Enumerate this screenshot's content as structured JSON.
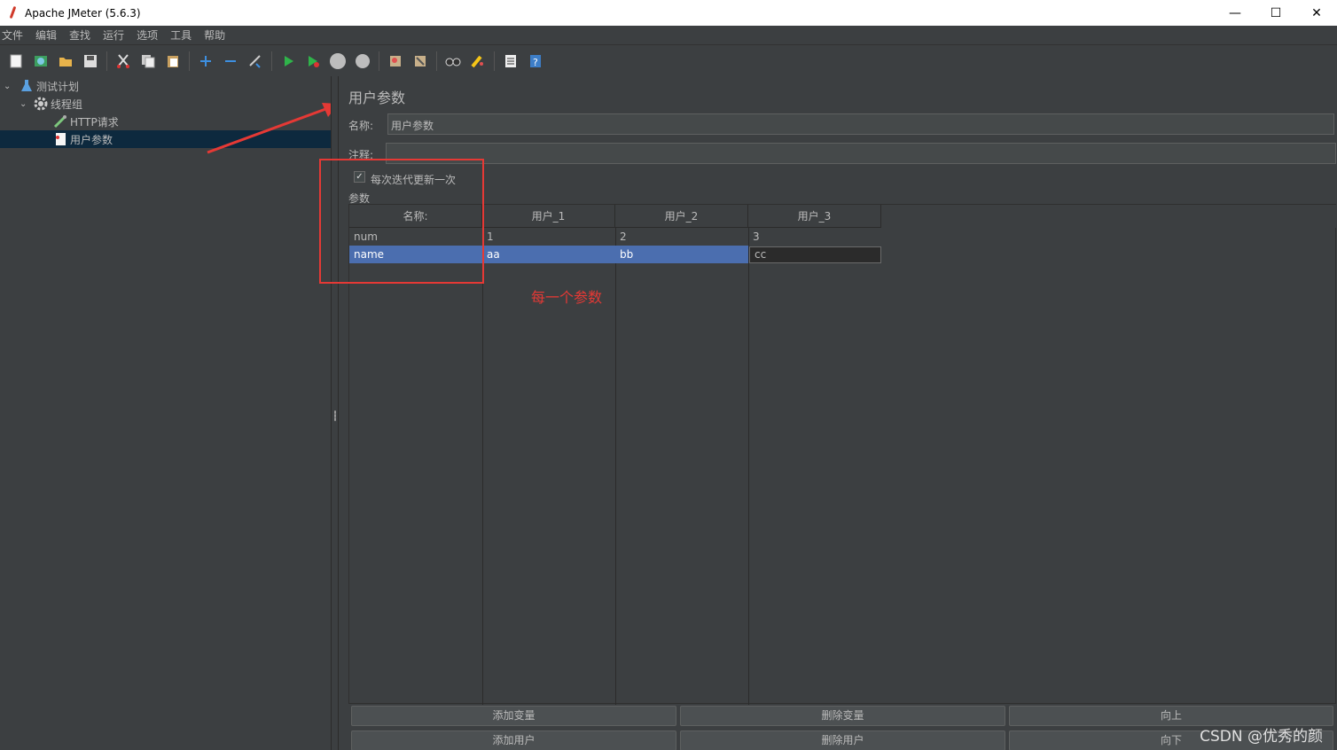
{
  "window": {
    "title": "Apache JMeter (5.6.3)",
    "min": "—",
    "max": "☐",
    "close": "✕"
  },
  "menu": [
    "文件",
    "编辑",
    "查找",
    "运行",
    "选项",
    "工具",
    "帮助"
  ],
  "toolbar_icons": [
    "new-icon",
    "templates-icon",
    "open-icon",
    "save-icon",
    "cut-icon",
    "copy-icon",
    "paste-icon",
    "expand-icon",
    "collapse-icon",
    "toggle-icon",
    "start-icon",
    "start-no-pause-icon",
    "stop-icon",
    "shutdown-icon",
    "clear-icon",
    "clear-all-icon",
    "search-icon",
    "reset-search-icon",
    "function-helper-icon",
    "help-icon"
  ],
  "tree": {
    "test_plan": "测试计划",
    "thread_group": "线程组",
    "http_request": "HTTP请求",
    "user_params": "用户参数"
  },
  "panel": {
    "title": "用户参数",
    "name_label": "名称:",
    "name_value": "用户参数",
    "comment_label": "注释:",
    "comment_value": "",
    "checkbox_label": "每次迭代更新一次",
    "checkbox_checked": true,
    "params_label": "参数"
  },
  "table": {
    "headers": [
      "名称:",
      "用户_1",
      "用户_2",
      "用户_3"
    ],
    "rows": [
      [
        "num",
        "1",
        "2",
        "3"
      ],
      [
        "name",
        "aa",
        "bb",
        "cc"
      ]
    ]
  },
  "buttons": {
    "add_var": "添加变量",
    "del_var": "删除变量",
    "up": "向上",
    "add_user": "添加用户",
    "del_user": "删除用户",
    "down": "向下"
  },
  "annotation": {
    "note": "每一个参数",
    "color": "#e53935"
  },
  "watermark": "CSDN @优秀的颜"
}
